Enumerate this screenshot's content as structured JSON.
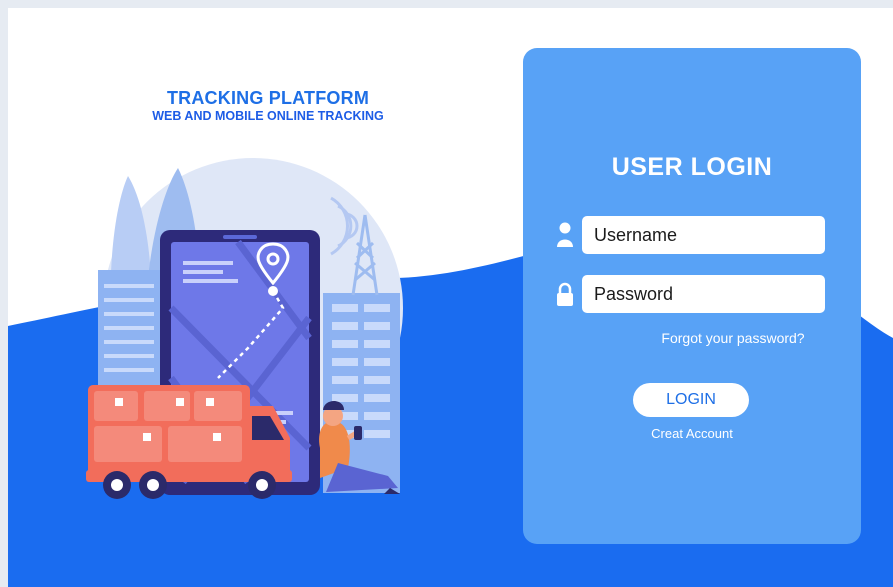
{
  "brand": {
    "title": "TRACKING PLATFORM",
    "subtitle": "WEB AND MOBILE ONLINE TRACKING"
  },
  "login": {
    "title": "USER LOGIN",
    "username_placeholder": "Username",
    "password_placeholder": "Password",
    "forgot_label": "Forgot your password?",
    "login_label": "LOGIN",
    "create_label": "Creat Account"
  },
  "colors": {
    "wave_blue": "#1a6cf0",
    "panel_blue": "#58a2f6",
    "brand_blue": "#1e6fe6",
    "truck_red": "#f26d5b"
  },
  "icons": {
    "username": "user-icon",
    "password": "lock-icon"
  }
}
